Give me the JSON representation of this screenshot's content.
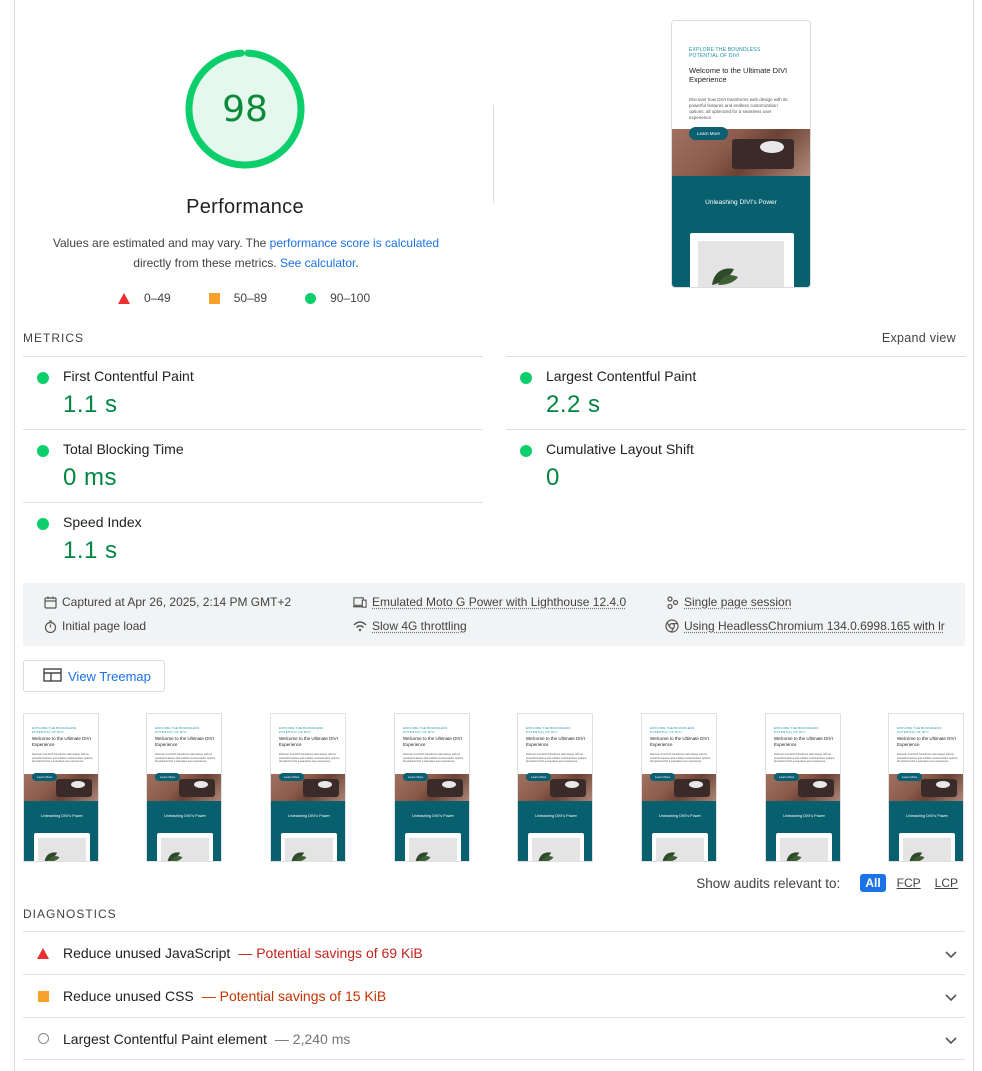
{
  "score": {
    "value": "98",
    "label": "Performance",
    "fraction": 0.98,
    "color": "#0cce6b"
  },
  "description": {
    "pre": "Values are estimated and may vary. The ",
    "link1": "performance score is calculated",
    "mid": " directly from these metrics. ",
    "link2": "See calculator",
    "post": "."
  },
  "legend": [
    {
      "label": "0–49",
      "color": "#eb2f2f",
      "shape": "triangle"
    },
    {
      "label": "50–89",
      "color": "#f7a02a",
      "shape": "square"
    },
    {
      "label": "90–100",
      "color": "#0cce6b",
      "shape": "circle"
    }
  ],
  "screenshot": {
    "eyebrow": "EXPLORE THE BOUNDLESS POTENTIAL OF DIVI",
    "heading": "Welcome to the Ultimate DIVI Experience",
    "body": "Discover how DIVI transforms web design with its powerful features and endless customization options, all optimized for a seamless user experience.",
    "button": "Learn More",
    "section_title": "Unleashing DIVI's Power"
  },
  "metrics": {
    "section_label": "METRICS",
    "expand": "Expand view",
    "items": [
      {
        "name": "First Contentful Paint",
        "value": "1.1 s"
      },
      {
        "name": "Largest Contentful Paint",
        "value": "2.2 s"
      },
      {
        "name": "Total Blocking Time",
        "value": "0 ms"
      },
      {
        "name": "Cumulative Layout Shift",
        "value": "0"
      },
      {
        "name": "Speed Index",
        "value": "1.1 s"
      }
    ]
  },
  "info": {
    "captured": "Captured at Apr 26, 2025, 2:14 PM GMT+2",
    "load": "Initial page load",
    "device": "Emulated Moto G Power with Lighthouse 12.4.0",
    "throttle": "Slow 4G throttling",
    "session": "Single page session",
    "browser": "Using HeadlessChromium 134.0.6998.165 with lr"
  },
  "treemap": {
    "label": "View Treemap"
  },
  "filter": {
    "label": "Show audits relevant to:",
    "options": [
      "All",
      "FCP",
      "LCP"
    ]
  },
  "diagnostics": {
    "section_label": "DIAGNOSTICS",
    "items": [
      {
        "title": "Reduce unused JavaScript",
        "saving": "— Potential savings of 69 KiB",
        "severity": "fail",
        "color": "#c5221f"
      },
      {
        "title": "Reduce unused CSS",
        "saving": "— Potential savings of 15 KiB",
        "severity": "average",
        "color": "#c33300"
      },
      {
        "title": "Largest Contentful Paint element",
        "saving": "— 2,240 ms",
        "severity": "info",
        "color": "#757575"
      }
    ]
  }
}
